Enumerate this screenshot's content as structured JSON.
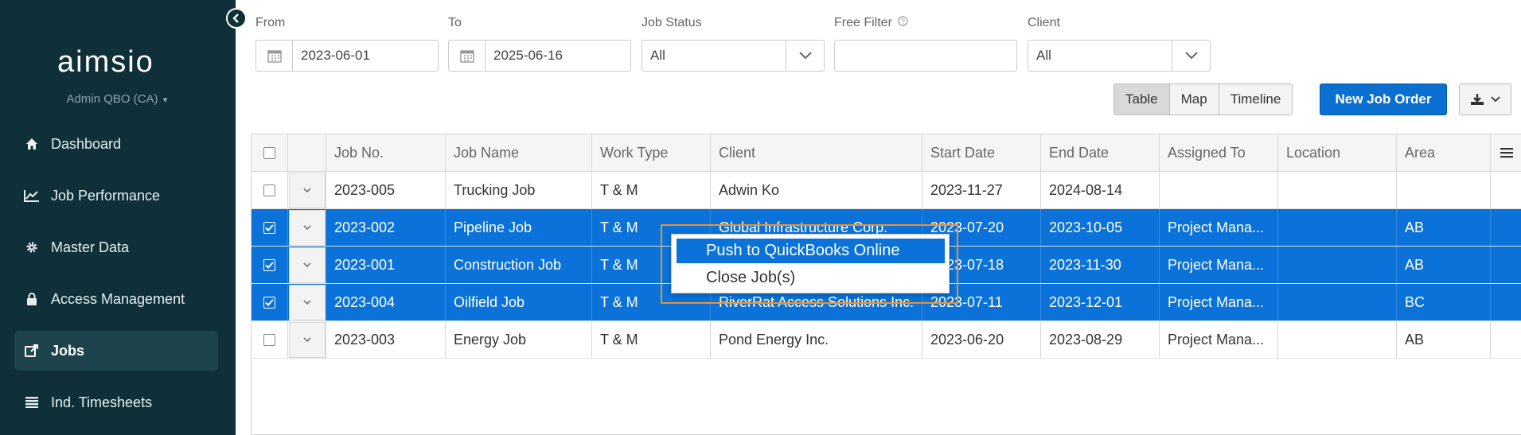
{
  "app": {
    "logo_text": "aimsio",
    "account_label": "Admin QBO (CA)"
  },
  "sidebar": {
    "items": [
      {
        "label": "Dashboard",
        "icon": "home-icon"
      },
      {
        "label": "Job Performance",
        "icon": "chart-line-icon"
      },
      {
        "label": "Master Data",
        "icon": "gear-icon"
      },
      {
        "label": "Access Management",
        "icon": "lock-icon"
      },
      {
        "label": "Jobs",
        "icon": "external-link-icon",
        "active": true
      },
      {
        "label": "Ind. Timesheets",
        "icon": "list-icon"
      }
    ]
  },
  "filters": {
    "from": {
      "label": "From",
      "value": "2023-06-01"
    },
    "to": {
      "label": "To",
      "value": "2025-06-16"
    },
    "job_status": {
      "label": "Job Status",
      "value": "All"
    },
    "free_filter": {
      "label": "Free Filter",
      "value": ""
    },
    "client": {
      "label": "Client",
      "value": "All"
    }
  },
  "views": {
    "table": "Table",
    "map": "Map",
    "timeline": "Timeline",
    "selected": "Table"
  },
  "actions": {
    "new_job_order": "New Job Order"
  },
  "table": {
    "headers": [
      "Job No.",
      "Job Name",
      "Work Type",
      "Client",
      "Start Date",
      "End Date",
      "Assigned To",
      "Location",
      "Area"
    ],
    "rows": [
      {
        "selected": false,
        "job_no": "2023-005",
        "job_name": "Trucking Job",
        "work_type": "T & M",
        "client": "Adwin Ko",
        "start": "2023-11-27",
        "end": "2024-08-14",
        "assigned": "",
        "location": "",
        "area": ""
      },
      {
        "selected": true,
        "job_no": "2023-002",
        "job_name": "Pipeline Job",
        "work_type": "T & M",
        "client": "Global Infrastructure Corp.",
        "start": "2023-07-20",
        "end": "2023-10-05",
        "assigned": "Project Mana...",
        "location": "",
        "area": "AB"
      },
      {
        "selected": true,
        "job_no": "2023-001",
        "job_name": "Construction Job",
        "work_type": "T & M",
        "client": "",
        "start": "2023-07-18",
        "end": "2023-11-30",
        "assigned": "Project Mana...",
        "location": "",
        "area": "AB"
      },
      {
        "selected": true,
        "job_no": "2023-004",
        "job_name": "Oilfield Job",
        "work_type": "T & M",
        "client": "RiverRat Access Solutions Inc.",
        "start": "2023-07-11",
        "end": "2023-12-01",
        "assigned": "Project Mana...",
        "location": "",
        "area": "BC"
      },
      {
        "selected": false,
        "job_no": "2023-003",
        "job_name": "Energy Job",
        "work_type": "T & M",
        "client": "Pond Energy Inc.",
        "start": "2023-06-20",
        "end": "2023-08-29",
        "assigned": "Project Mana...",
        "location": "",
        "area": "AB"
      }
    ]
  },
  "context_menu": {
    "items": [
      "Push to QuickBooks Online",
      "Close Job(s)"
    ]
  },
  "colors": {
    "sidebar_bg": "#0f3038",
    "accent": "#0a72d8",
    "highlight": "#f0902c"
  }
}
